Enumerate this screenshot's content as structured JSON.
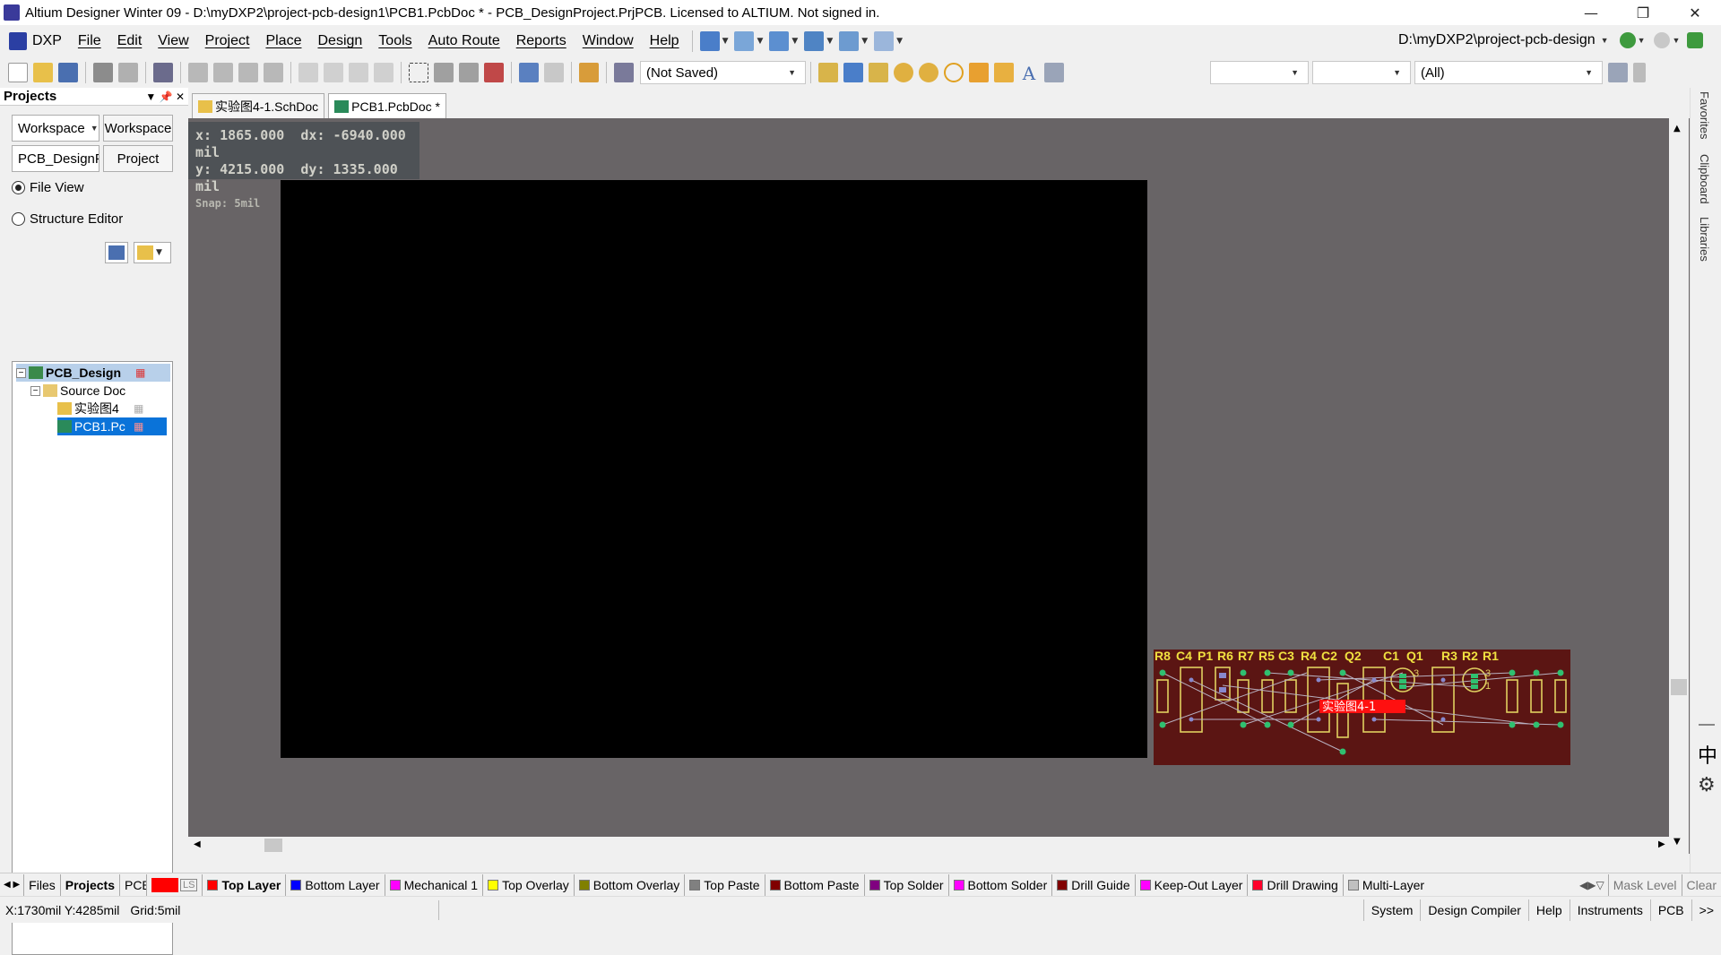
{
  "window": {
    "title": "Altium Designer Winter 09 - D:\\myDXP2\\project-pcb-design1\\PCB1.PcbDoc * - PCB_DesignProject.PrjPCB. Licensed to ALTIUM. Not signed in."
  },
  "menu": {
    "items": [
      "DXP",
      "File",
      "Edit",
      "View",
      "Project",
      "Place",
      "Design",
      "Tools",
      "Auto Route",
      "Reports",
      "Window",
      "Help"
    ]
  },
  "path_combo": "D:\\myDXP2\\project-pcb-design",
  "toolbar": {
    "not_saved": "(Not Saved)",
    "filter_all": "(All)"
  },
  "panel": {
    "title": "Projects",
    "workspace_combo": "Workspace",
    "workspace_btn": "Workspace",
    "project_field": "PCB_DesignPr",
    "project_btn": "Project",
    "file_view": "File View",
    "structure_editor": "Structure Editor",
    "tree": {
      "project": "PCB_Design",
      "folder": "Source Doc",
      "sch": "实验图4",
      "pcb": "PCB1.Pc"
    }
  },
  "doc_tabs": [
    "实验图4-1.SchDoc",
    "PCB1.PcbDoc *"
  ],
  "coords": {
    "x": "x:  1865.000",
    "dx": "dx: -6940.000 mil",
    "y": "y:  4215.000",
    "dy": "dy:  1335.000  mil",
    "snap": "Snap: 5mil"
  },
  "pcb": {
    "designators": [
      "R8",
      "C4",
      "P1",
      "R6",
      "R7",
      "R5",
      "C3",
      "R4",
      "C2",
      "Q2",
      "C1",
      "Q1",
      "R3",
      "R2",
      "R1"
    ],
    "room_label": "实验图4-1",
    "pin_3a": "3",
    "pin_3b": "3",
    "pin_1": "1"
  },
  "bottom_tabs": {
    "files": "Files",
    "projects": "Projects",
    "pcb": "PCB"
  },
  "layer_swatch_label": "LS",
  "layers": [
    {
      "name": "Top Layer",
      "color": "#ff0000"
    },
    {
      "name": "Bottom Layer",
      "color": "#0000ff"
    },
    {
      "name": "Mechanical 1",
      "color": "#ff00ff"
    },
    {
      "name": "Top Overlay",
      "color": "#ffff00"
    },
    {
      "name": "Bottom Overlay",
      "color": "#808000"
    },
    {
      "name": "Top Paste",
      "color": "#808080"
    },
    {
      "name": "Bottom Paste",
      "color": "#800000"
    },
    {
      "name": "Top Solder",
      "color": "#800080"
    },
    {
      "name": "Bottom Solder",
      "color": "#ff00ff"
    },
    {
      "name": "Drill Guide",
      "color": "#800000"
    },
    {
      "name": "Keep-Out Layer",
      "color": "#ff00ff"
    },
    {
      "name": "Drill Drawing",
      "color": "#ff002a"
    },
    {
      "name": "Multi-Layer",
      "color": "#c0c0c0"
    }
  ],
  "layer_actions": {
    "mask_level": "Mask Level",
    "clear": "Clear"
  },
  "status": {
    "coords": "X:1730mil Y:4285mil",
    "grid": "Grid:5mil",
    "buttons": [
      "System",
      "Design Compiler",
      "Help",
      "Instruments",
      "PCB"
    ],
    "more": ">>"
  },
  "right_tabs": [
    "Favorites",
    "Clipboard",
    "Libraries"
  ],
  "ime": {
    "cn": "中"
  }
}
